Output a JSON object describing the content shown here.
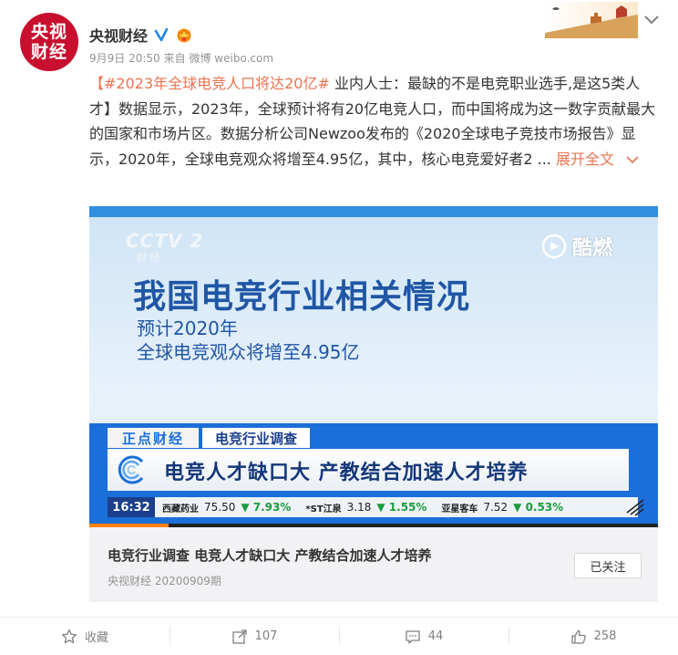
{
  "author": {
    "avatar_text_line1": "央视",
    "avatar_text_line2": "财经",
    "name": "央视财经",
    "time": "9月9日 20:50",
    "source": "来自 微博 weibo.com"
  },
  "post": {
    "hashtag": "【#2023年全球电竞人口将达20亿#",
    "body": " 业内人士：最缺的不是电竞职业选手,是这5类人才】数据显示，2023年，全球预计将有20亿电竞人口，而中国将成为这一数字贡献最大的国家和市场片区。数据分析公司Newzoo发布的《2020全球电子竞技市场报告》显示，2020年，全球电竞观众将增至4.95亿，其中，核心电竞爱好者2 ... ",
    "expand_label": "展开全文",
    "expand_icon": "chevron-down-icon"
  },
  "video": {
    "cctv_logo": "CCTV 2",
    "cctv_sub": "财 经",
    "watermark": "酷燃",
    "headline": "我国电竞行业相关情况",
    "sub1": "预计2020年",
    "sub2": "全球电竞观众将增至4.95亿",
    "tag1": "正点财经",
    "tag2": "电竞行业调查",
    "caption": "电竞人才缺口大  产教结合加速人才培养",
    "ticker_time": "16:32",
    "ticker": [
      {
        "name": "西藏药业",
        "price": "75.50",
        "change": "▼ 7.93%"
      },
      {
        "name": "*ST江泉",
        "price": "3.18",
        "change": "▼ 1.55%"
      },
      {
        "name": "亚星客车",
        "price": "7.52",
        "change": "▼ 0.53%"
      }
    ],
    "progress": 0.14,
    "accent": "#ff8200",
    "brand_blue": "#1b6fd8"
  },
  "card": {
    "title": "电竞行业调查 电竞人才缺口大 产教结合加速人才培养",
    "subtitle": "央视财经 20200909期",
    "follow_label": "已关注"
  },
  "actions": {
    "favorite_label": "收藏",
    "repost_count": "107",
    "comment_count": "44",
    "like_count": "258"
  }
}
